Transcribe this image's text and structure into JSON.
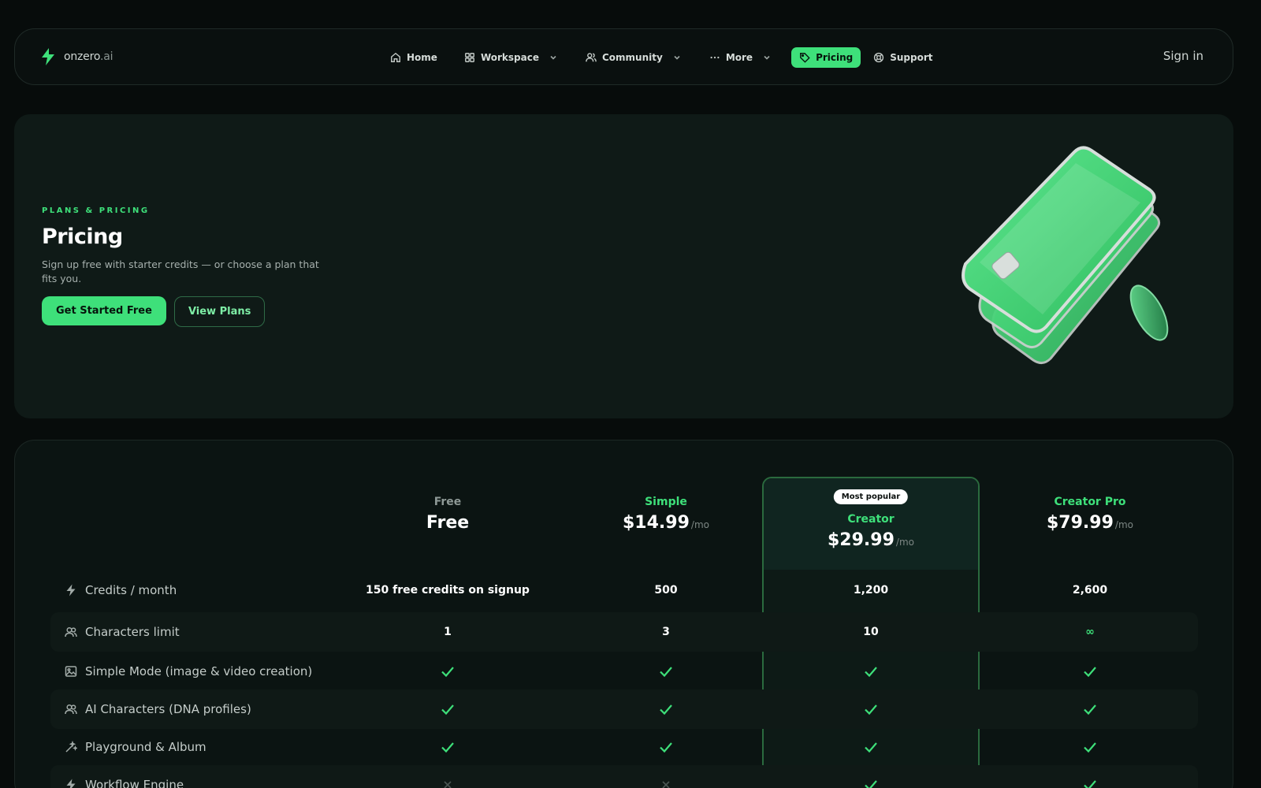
{
  "brand": {
    "name_main": "onzero",
    "name_suffix": ".ai",
    "accent": "#3ee07a"
  },
  "nav": {
    "items": [
      {
        "label": "Home",
        "icon": "home-icon"
      },
      {
        "label": "Workspace",
        "icon": "grid-icon",
        "dropdown": true
      },
      {
        "label": "Community",
        "icon": "users-icon",
        "dropdown": true
      },
      {
        "label": "More",
        "icon": "dots-icon",
        "dropdown": true
      },
      {
        "label": "Pricing",
        "icon": "tag-icon",
        "active": true
      },
      {
        "label": "Support",
        "icon": "lifebuoy-icon"
      }
    ],
    "signin": "Sign in"
  },
  "hero": {
    "eyebrow": "PLANS & PRICING",
    "title": "Pricing",
    "subtitle": "Sign up free with starter credits — or choose a plan that fits you.",
    "primary_cta": "Get Started Free",
    "secondary_cta": "View Plans"
  },
  "plans": [
    {
      "name": "Free",
      "price": "Free",
      "per": ""
    },
    {
      "name": "Simple",
      "price": "$14.99",
      "per": "/mo"
    },
    {
      "name": "Creator",
      "price": "$29.99",
      "per": "/mo",
      "badge": "Most popular"
    },
    {
      "name": "Creator Pro",
      "price": "$79.99",
      "per": "/mo"
    }
  ],
  "features": [
    {
      "label": "Credits / month",
      "icon": "bolt-icon",
      "values": [
        "150 free credits on signup",
        "500",
        "1,200",
        "2,600"
      ]
    },
    {
      "label": "Characters limit",
      "icon": "users-icon",
      "values": [
        "1",
        "3",
        "10",
        "∞"
      ]
    },
    {
      "label": "Simple Mode (image & video creation)",
      "icon": "image-icon",
      "values": [
        "check",
        "check",
        "check",
        "check"
      ]
    },
    {
      "label": "AI Characters (DNA profiles)",
      "icon": "users-icon",
      "values": [
        "check",
        "check",
        "check",
        "check"
      ]
    },
    {
      "label": "Playground & Album",
      "icon": "wand-icon",
      "values": [
        "check",
        "check",
        "check",
        "check"
      ]
    },
    {
      "label": "Workflow Engine",
      "icon": "bolt-icon",
      "values": [
        "cross",
        "cross",
        "check",
        "check"
      ]
    }
  ]
}
